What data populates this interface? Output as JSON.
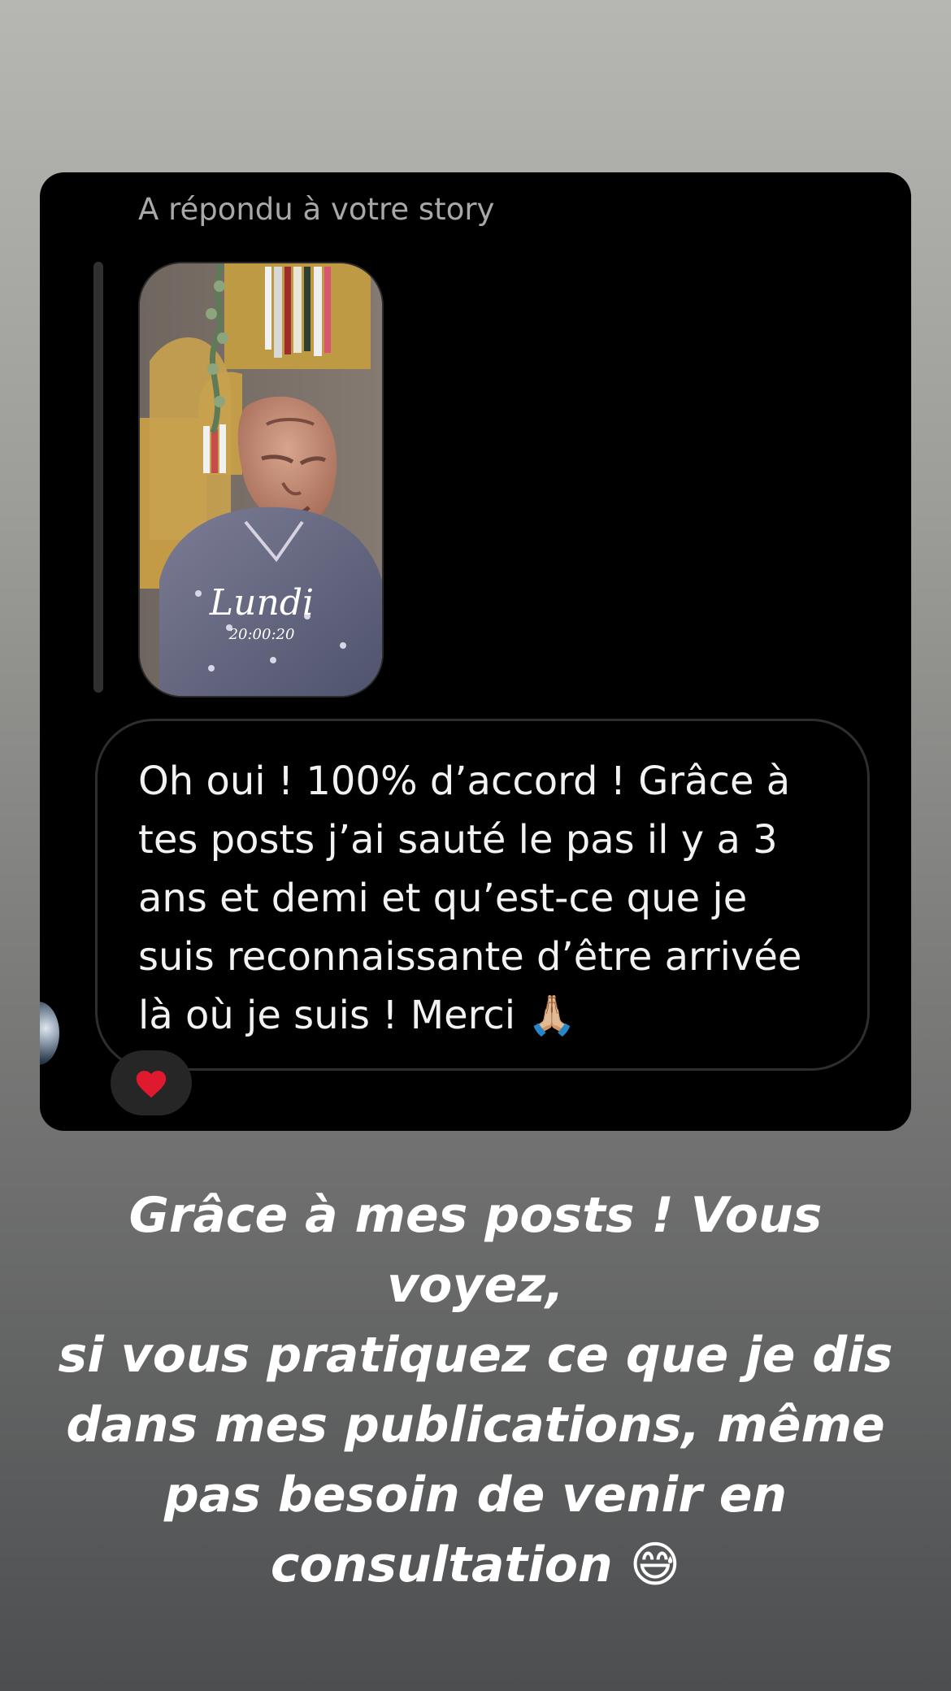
{
  "dm": {
    "reply_label": "A répondu à votre story",
    "story_overlay": {
      "script_word": "Lundi",
      "time": "20:00:20"
    },
    "message": "Oh oui ! 100% d’accord ! Grâce à\ntes posts j’ai sauté le pas il y a 3\nans et demi et qu’est-ce que je\nsuis reconnaissante d’être arrivée\nlà où je suis ! Merci 🙏🏼",
    "reaction": "❤️"
  },
  "caption": "Grâce à mes posts ! Vous voyez,\nsi vous pratiquez ce que je dis\ndans mes publications, même\npas besoin de venir en\nconsultation 😅",
  "colors": {
    "card_background": "#000000",
    "reply_label": "#a8a8a8",
    "bubble_border": "#2e2e2e",
    "reaction_pill": "#262626",
    "caption_text": "#ffffff",
    "heart": "#e01a2e"
  },
  "icons": {
    "reaction_icon": "heart-icon",
    "avatar": "profile-avatar"
  }
}
